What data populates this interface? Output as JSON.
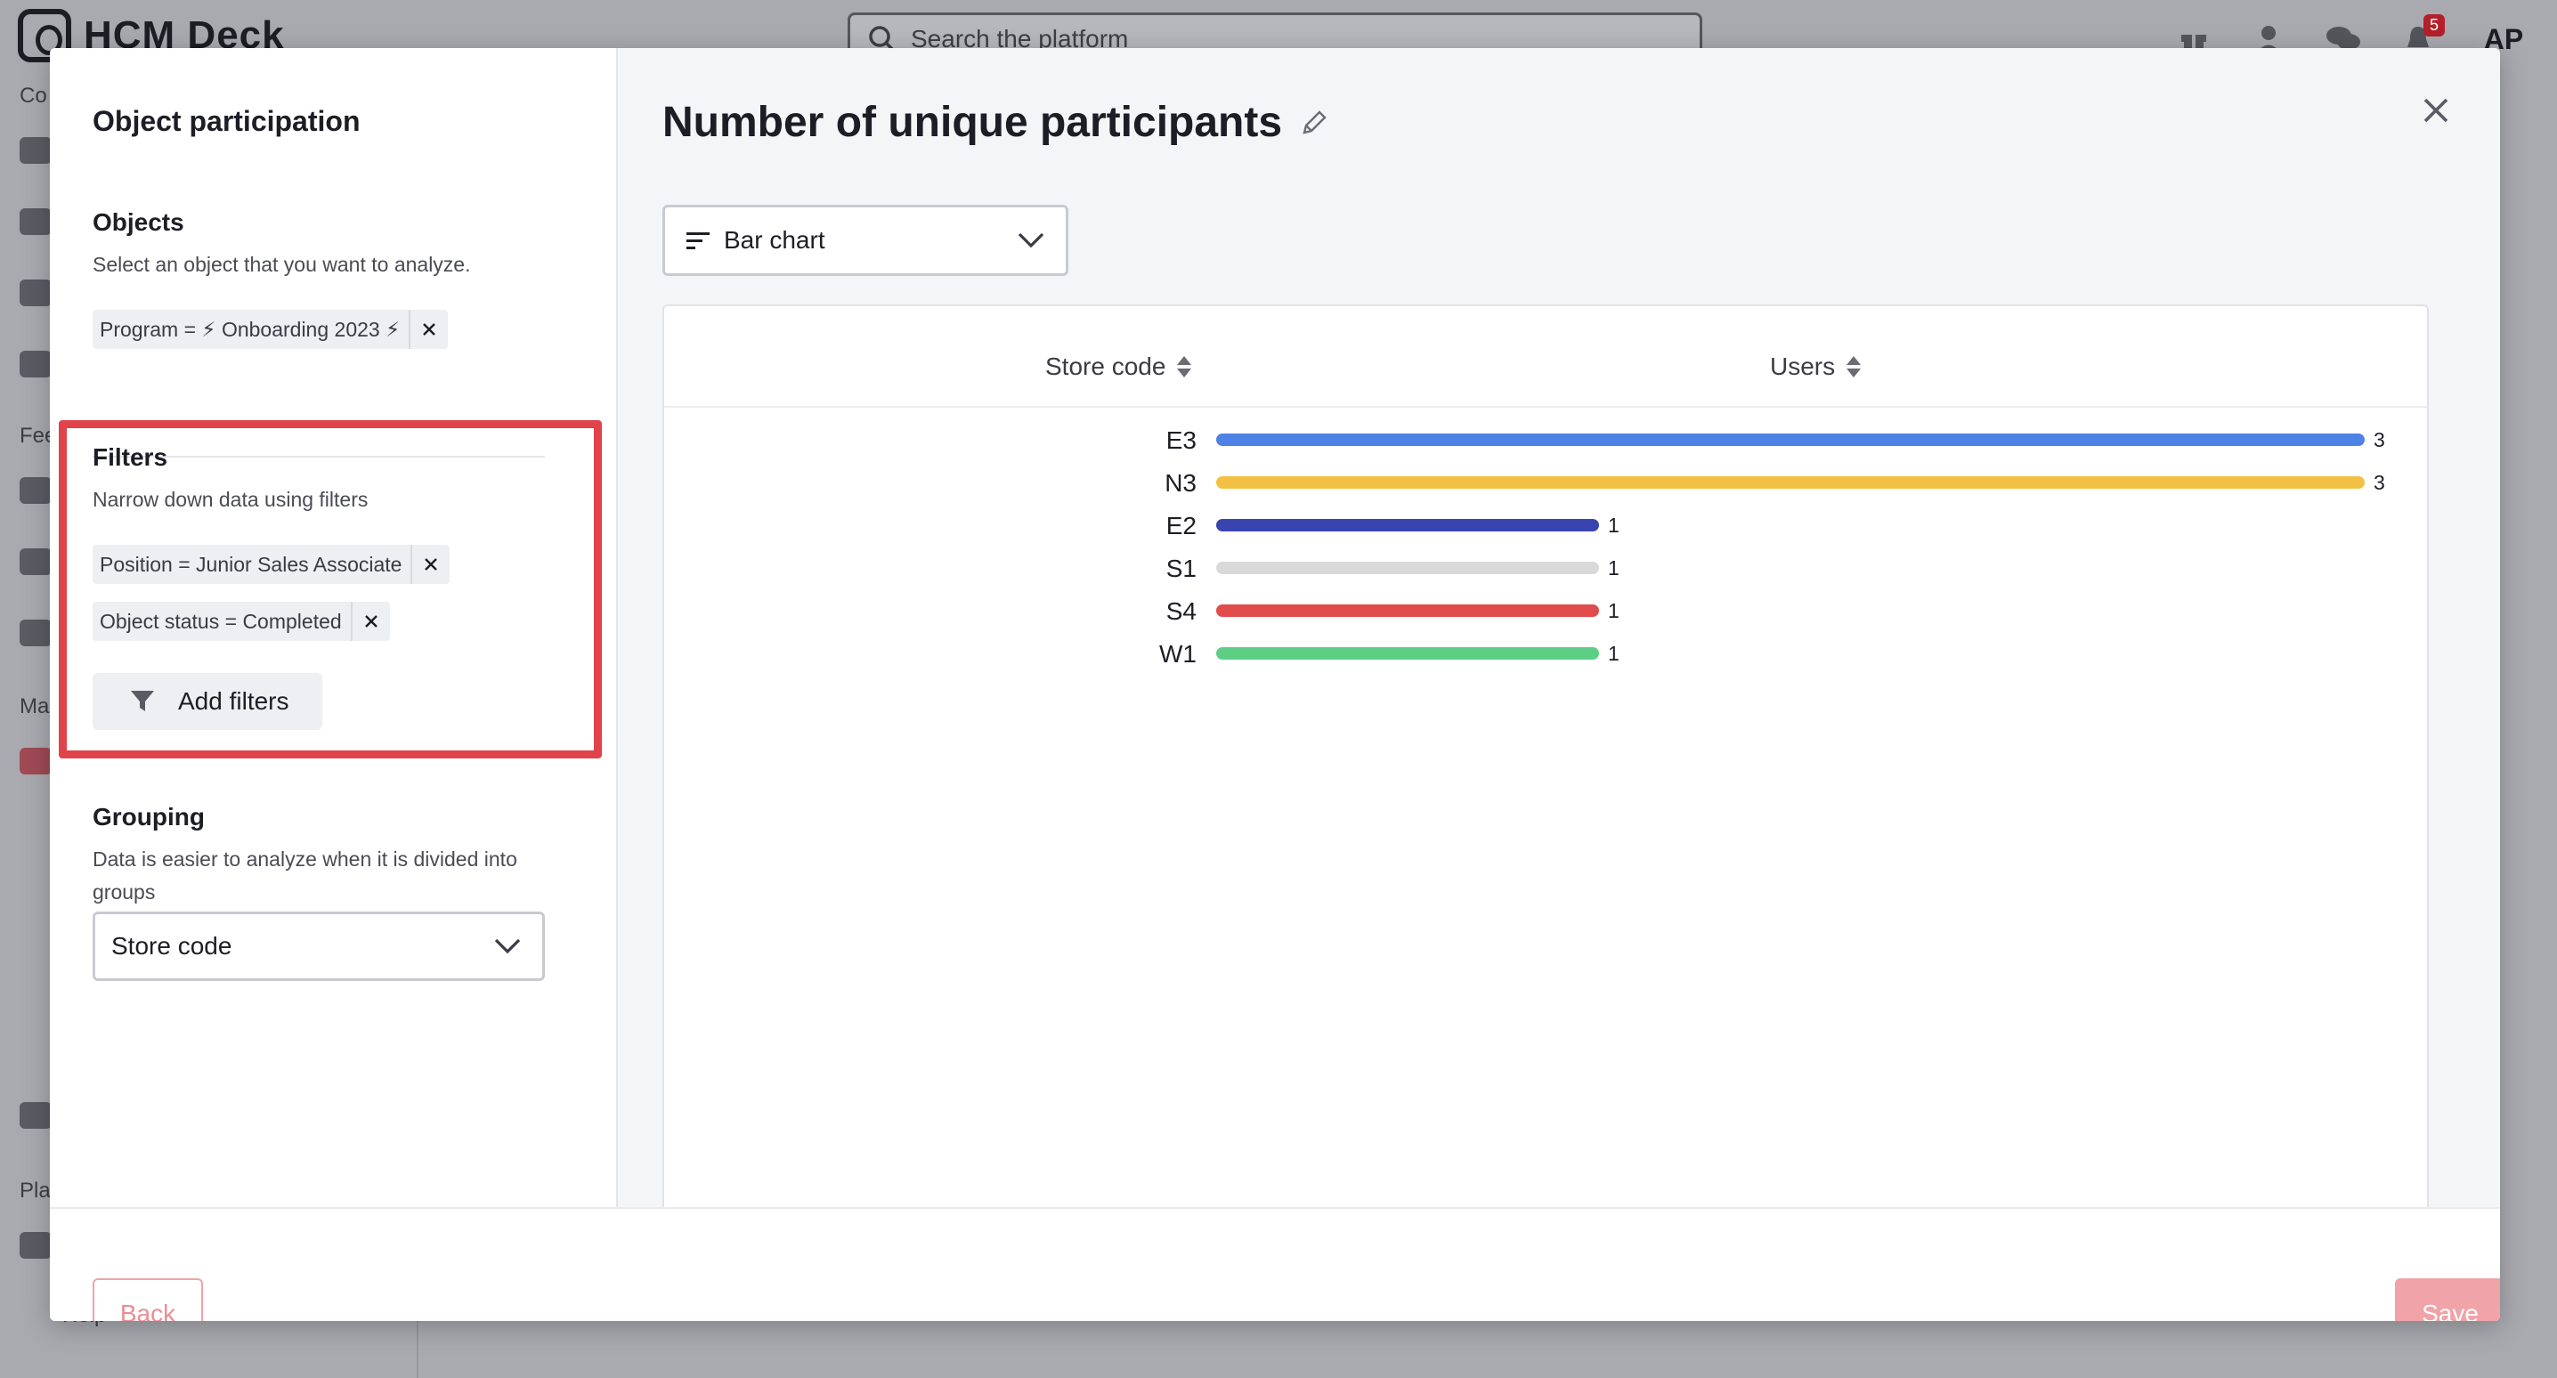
{
  "app": {
    "logo_text": "HCM Deck",
    "search_placeholder": "Search the platform",
    "notifications_count": "5",
    "avatar_initials": "AP",
    "sidebar_fragments": [
      "Co",
      "Fee",
      "Ma",
      "Pla",
      "Help"
    ]
  },
  "modal": {
    "left_title": "Object participation",
    "objects": {
      "title": "Objects",
      "subtitle": "Select an object that you want to analyze.",
      "chips": [
        {
          "label": "Program = ⚡ Onboarding 2023 ⚡"
        }
      ]
    },
    "filters": {
      "title": "Filters",
      "subtitle": "Narrow down data using filters",
      "chips": [
        {
          "label": "Position = Junior Sales Associate"
        },
        {
          "label": "Object status = Completed"
        }
      ],
      "add_button": "Add filters"
    },
    "grouping": {
      "title": "Grouping",
      "subtitle": "Data is easier to analyze when it is divided into groups",
      "selected": "Store code"
    },
    "chart_title": "Number of unique participants",
    "chart_type_selected": "Bar chart",
    "columns": {
      "group": "Store code",
      "value": "Users"
    },
    "footer": {
      "back_label": "Back",
      "save_label": "Save"
    }
  },
  "colors": {
    "highlight": "#e0434a",
    "E3": "#4f82e6",
    "N3": "#f2c144",
    "E2": "#3845b0",
    "S1": "#d9d9d9",
    "S4": "#e04b4b",
    "W1": "#5ccf85"
  },
  "chart_data": {
    "type": "bar",
    "orientation": "horizontal",
    "categories": [
      "E3",
      "N3",
      "E2",
      "S1",
      "S4",
      "W1"
    ],
    "values": [
      3,
      3,
      1,
      1,
      1,
      1
    ],
    "xlabel": "Users",
    "ylabel": "Store code",
    "xlim": [
      0,
      3
    ],
    "data_labels": true,
    "grid": false,
    "legend": "none"
  }
}
